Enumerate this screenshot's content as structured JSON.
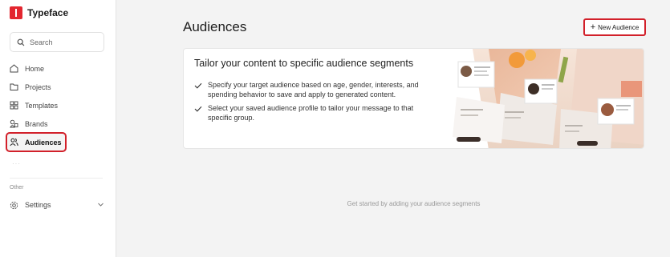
{
  "app": {
    "name": "Typeface"
  },
  "search": {
    "placeholder": "Search"
  },
  "sidebar": {
    "items": [
      {
        "label": "Home",
        "icon": "home-icon"
      },
      {
        "label": "Projects",
        "icon": "folder-icon"
      },
      {
        "label": "Templates",
        "icon": "grid-icon"
      },
      {
        "label": "Brands",
        "icon": "brands-icon"
      },
      {
        "label": "Audiences",
        "icon": "users-icon",
        "active": true
      }
    ],
    "other_label": "Other",
    "settings_label": "Settings"
  },
  "main": {
    "title": "Audiences",
    "new_button": "New Audience",
    "card": {
      "title": "Tailor your content to specific audience segments",
      "bullets": [
        "Specify your target audience based on age, gender, interests, and spending behavior to save and apply to generated content.",
        "Select your saved audience profile to tailor your message to that specific group."
      ]
    },
    "empty_message": "Get started by adding your audience segments"
  },
  "colors": {
    "accent": "#d2202a",
    "brand": "#e3262f"
  }
}
